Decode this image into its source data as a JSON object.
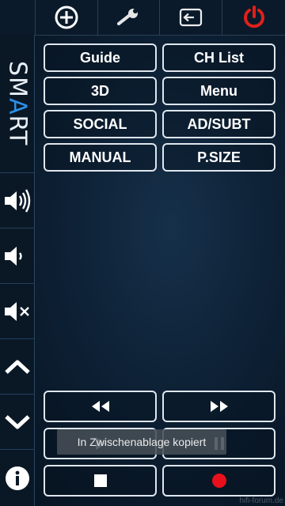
{
  "topbar": {
    "icons": [
      "add-circle-icon",
      "wrench-icon",
      "input-source-icon",
      "power-icon"
    ],
    "power_color": "#e0201b"
  },
  "sidebar": {
    "logo_part1": "SM",
    "logo_accent": "A",
    "logo_part2": "RT",
    "accent_color": "#2e8fe8",
    "icons": [
      "volume-up-icon",
      "volume-down-icon",
      "mute-icon",
      "chevron-up-icon",
      "chevron-down-icon",
      "info-icon"
    ]
  },
  "buttons": {
    "guide": "Guide",
    "ch_list": "CH List",
    "three_d": "3D",
    "menu": "Menu",
    "social": "SOCIAL",
    "ad_subt": "AD/SUBT",
    "manual": "MANUAL",
    "psize": "P.SIZE"
  },
  "media": {
    "icons": [
      "rewind-icon",
      "fast-forward-icon",
      "play-icon",
      "pause-icon",
      "stop-icon",
      "record-icon"
    ],
    "record_color": "#e8101a"
  },
  "toast": {
    "text": "In Zwischenablage kopiert"
  },
  "watermark": "hifi-forum.de"
}
